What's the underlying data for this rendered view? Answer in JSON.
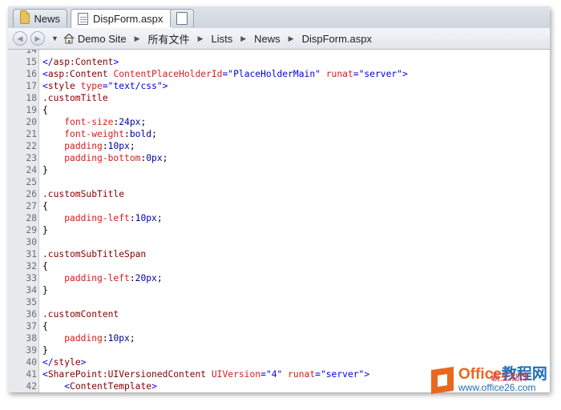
{
  "tabs": [
    {
      "label": "News"
    },
    {
      "label": "DispForm.aspx"
    }
  ],
  "breadcrumb": [
    "Demo Site",
    "所有文件",
    "Lists",
    "News",
    "DispForm.aspx"
  ],
  "code_lines": [
    {
      "n": "14",
      "parts": []
    },
    {
      "n": "15",
      "parts": [
        [
          "p",
          "</"
        ],
        [
          "t",
          "asp:Content"
        ],
        [
          "p",
          ">"
        ]
      ]
    },
    {
      "n": "16",
      "parts": [
        [
          "p",
          "<"
        ],
        [
          "t",
          "asp:Content"
        ],
        [
          "br",
          " "
        ],
        [
          "a",
          "ContentPlaceHolderId"
        ],
        [
          "p",
          "="
        ],
        [
          "s",
          "\"PlaceHolderMain\""
        ],
        [
          "br",
          " "
        ],
        [
          "a",
          "runat"
        ],
        [
          "p",
          "="
        ],
        [
          "s",
          "\"server\""
        ],
        [
          "p",
          ">"
        ]
      ]
    },
    {
      "n": "17",
      "parts": [
        [
          "p",
          "<"
        ],
        [
          "t",
          "style"
        ],
        [
          "br",
          " "
        ],
        [
          "a",
          "type"
        ],
        [
          "p",
          "="
        ],
        [
          "s",
          "\"text/css\""
        ],
        [
          "p",
          ">"
        ]
      ]
    },
    {
      "n": "18",
      "parts": [
        [
          "sel",
          ".customTitle"
        ]
      ]
    },
    {
      "n": "19",
      "parts": [
        [
          "br",
          "{"
        ]
      ]
    },
    {
      "n": "20",
      "parts": [
        [
          "br",
          "    "
        ],
        [
          "prop",
          "font-size"
        ],
        [
          "br",
          ":"
        ],
        [
          "val",
          "24px"
        ],
        [
          "br",
          ";"
        ]
      ]
    },
    {
      "n": "21",
      "parts": [
        [
          "br",
          "    "
        ],
        [
          "prop",
          "font-weight"
        ],
        [
          "br",
          ":"
        ],
        [
          "val",
          "bold"
        ],
        [
          "br",
          ";"
        ]
      ]
    },
    {
      "n": "22",
      "parts": [
        [
          "br",
          "    "
        ],
        [
          "prop",
          "padding"
        ],
        [
          "br",
          ":"
        ],
        [
          "val",
          "10px"
        ],
        [
          "br",
          ";"
        ]
      ]
    },
    {
      "n": "23",
      "parts": [
        [
          "br",
          "    "
        ],
        [
          "prop",
          "padding-bottom"
        ],
        [
          "br",
          ":"
        ],
        [
          "val",
          "0px"
        ],
        [
          "br",
          ";"
        ]
      ]
    },
    {
      "n": "24",
      "parts": [
        [
          "br",
          "}"
        ]
      ]
    },
    {
      "n": "25",
      "parts": []
    },
    {
      "n": "26",
      "parts": [
        [
          "sel",
          ".customSubTitle"
        ]
      ]
    },
    {
      "n": "27",
      "parts": [
        [
          "br",
          "{"
        ]
      ]
    },
    {
      "n": "28",
      "parts": [
        [
          "br",
          "    "
        ],
        [
          "prop",
          "padding-left"
        ],
        [
          "br",
          ":"
        ],
        [
          "val",
          "10px"
        ],
        [
          "br",
          ";"
        ]
      ]
    },
    {
      "n": "29",
      "parts": [
        [
          "br",
          "}"
        ]
      ]
    },
    {
      "n": "30",
      "parts": []
    },
    {
      "n": "31",
      "parts": [
        [
          "sel",
          ".customSubTitleSpan"
        ]
      ]
    },
    {
      "n": "32",
      "parts": [
        [
          "br",
          "{"
        ]
      ]
    },
    {
      "n": "33",
      "parts": [
        [
          "br",
          "    "
        ],
        [
          "prop",
          "padding-left"
        ],
        [
          "br",
          ":"
        ],
        [
          "val",
          "20px"
        ],
        [
          "br",
          ";"
        ]
      ]
    },
    {
      "n": "34",
      "parts": [
        [
          "br",
          "}"
        ]
      ]
    },
    {
      "n": "35",
      "parts": []
    },
    {
      "n": "36",
      "parts": [
        [
          "sel",
          ".customContent"
        ]
      ]
    },
    {
      "n": "37",
      "parts": [
        [
          "br",
          "{"
        ]
      ]
    },
    {
      "n": "38",
      "parts": [
        [
          "br",
          "    "
        ],
        [
          "prop",
          "padding"
        ],
        [
          "br",
          ":"
        ],
        [
          "val",
          "10px"
        ],
        [
          "br",
          ";"
        ]
      ]
    },
    {
      "n": "39",
      "parts": [
        [
          "br",
          "}"
        ]
      ]
    },
    {
      "n": "40",
      "parts": [
        [
          "p",
          "</"
        ],
        [
          "t",
          "style"
        ],
        [
          "p",
          ">"
        ]
      ]
    },
    {
      "n": "41",
      "parts": [
        [
          "p",
          "<"
        ],
        [
          "t",
          "SharePoint:UIVersionedContent"
        ],
        [
          "br",
          " "
        ],
        [
          "a",
          "UIVersion"
        ],
        [
          "p",
          "="
        ],
        [
          "s",
          "\"4\""
        ],
        [
          "br",
          " "
        ],
        [
          "a",
          "runat"
        ],
        [
          "p",
          "="
        ],
        [
          "s",
          "\"server\""
        ],
        [
          "p",
          ">"
        ]
      ]
    },
    {
      "n": "42",
      "parts": [
        [
          "br",
          "    "
        ],
        [
          "p",
          "<"
        ],
        [
          "t",
          "ContentTemplate"
        ],
        [
          "p",
          ">"
        ]
      ]
    }
  ],
  "watermark": {
    "brand_a": "Office",
    "brand_b": "教程网",
    "url": "www.office26.com",
    "cn": "霸王制作"
  },
  "colors": {
    "tag": "#800000",
    "attribute": "#d22020",
    "string": "#0000e0",
    "watermark_orange": "#e8681e",
    "watermark_blue": "#1f6fb8"
  }
}
